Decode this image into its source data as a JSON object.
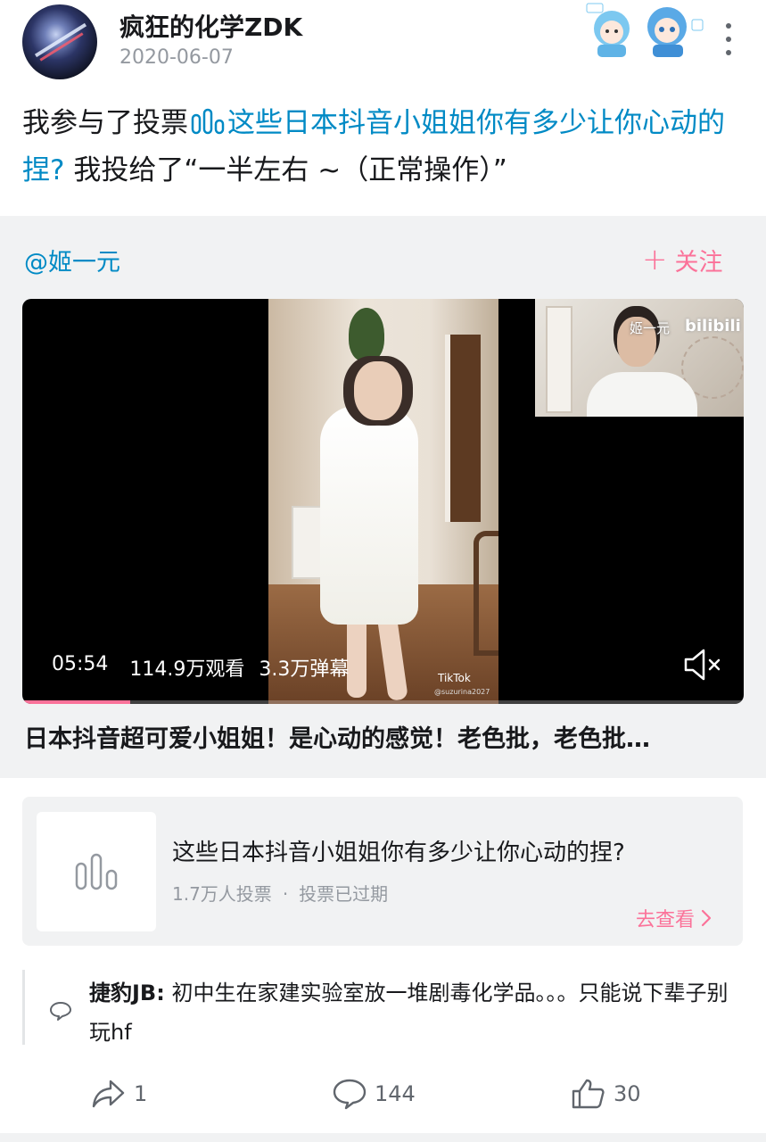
{
  "header": {
    "username": "疯狂的化学ZDK",
    "date": "2020-06-07"
  },
  "post": {
    "prefix": "我参与了投票",
    "vote_link": "这些日本抖音小姐姐你有多少让你心动的捏?",
    "suffix": "我投给了“一半左右 ~（正常操作）”"
  },
  "repost": {
    "author": "@姬一元",
    "follow_label": "关注",
    "video": {
      "duration": "05:54",
      "views": "114.9万观看",
      "danmaku": "3.3万弹幕",
      "progress": 0.15,
      "watermark_app": "TikTok",
      "watermark_handle": "@suzurina2027",
      "pip_name": "姬一元",
      "pip_brand": "bilibili"
    },
    "title": "日本抖音超可爱小姐姐！是心动的感觉！老色批，老色批…"
  },
  "vote_card": {
    "title": "这些日本抖音小姐姐你有多少让你心动的捏?",
    "voters": "1.7万人投票",
    "separator": "·",
    "status": "投票已过期",
    "view_label": "去查看"
  },
  "comment": {
    "author": "捷豹JB:",
    "text": "初中生在家建实验室放一堆剧毒化学品。。。只能说下辈子别玩hf"
  },
  "actions": {
    "share_count": "1",
    "comment_count": "144",
    "like_count": "30"
  },
  "colors": {
    "link": "#008ac5",
    "accent_pink": "#fb7299",
    "muted": "#9499a0",
    "panel_bg": "#f1f2f3"
  }
}
